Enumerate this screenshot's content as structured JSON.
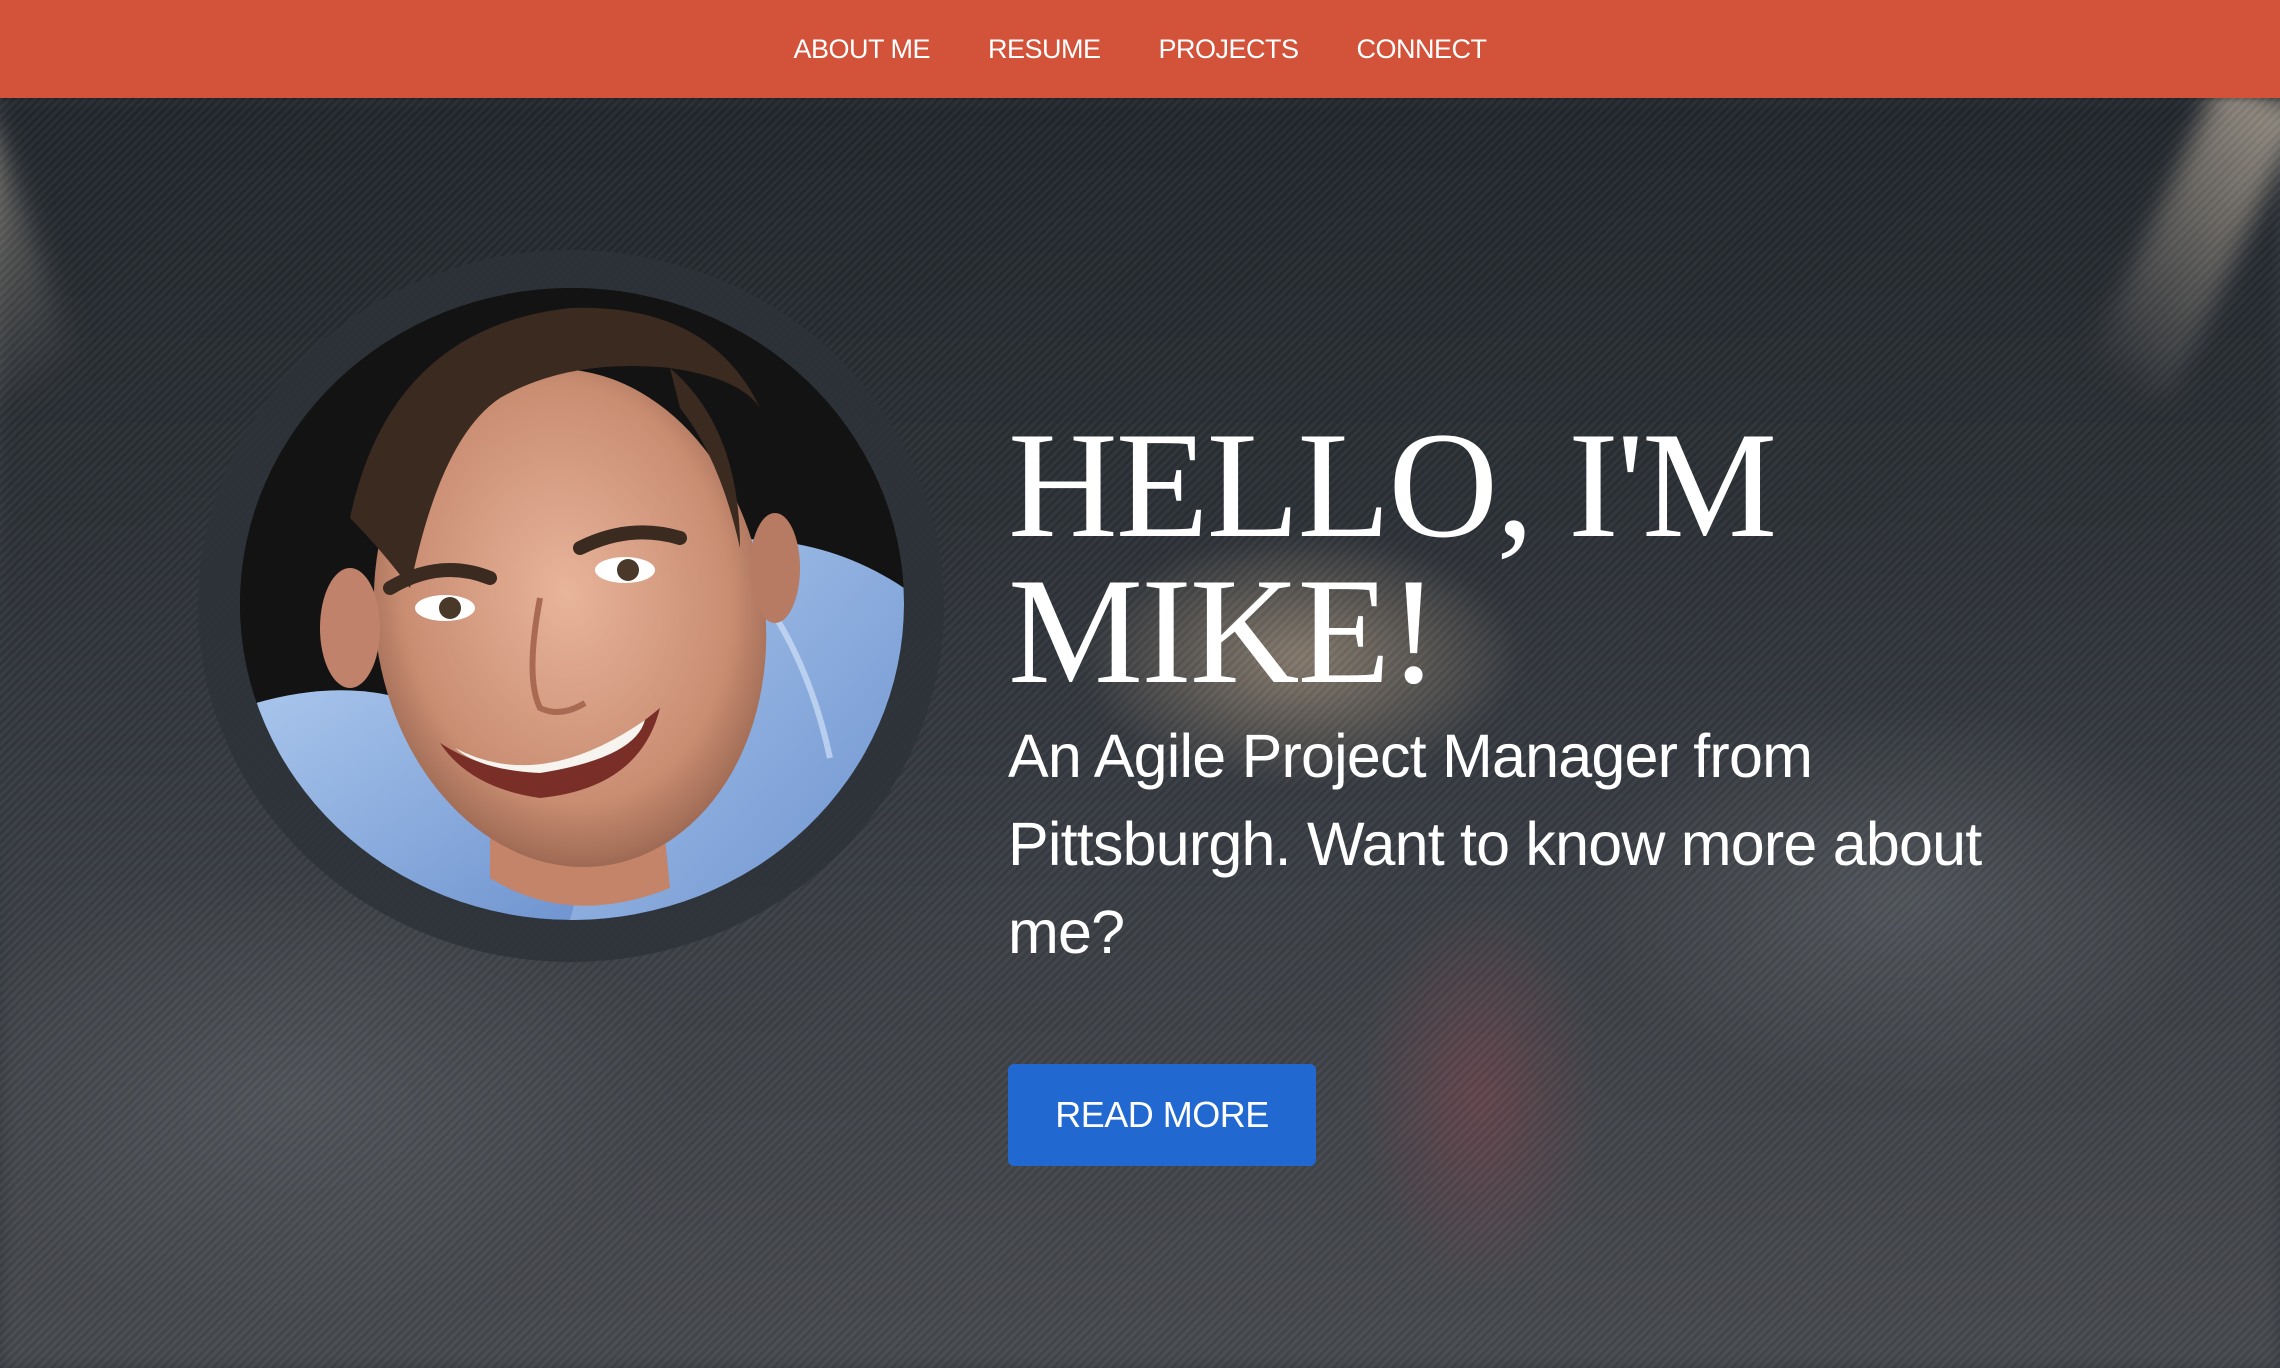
{
  "nav": {
    "items": [
      {
        "label": "ABOUT ME"
      },
      {
        "label": "RESUME"
      },
      {
        "label": "PROJECTS"
      },
      {
        "label": "CONNECT"
      }
    ]
  },
  "hero": {
    "title": "HELLO, I'M MIKE!",
    "subtitle": "An Agile Project Manager from Pittsburgh. Want to know more about me?",
    "button_label": "READ MORE"
  },
  "colors": {
    "nav_background": "#d2533a",
    "button_background": "#2168d0",
    "text": "#ffffff"
  }
}
